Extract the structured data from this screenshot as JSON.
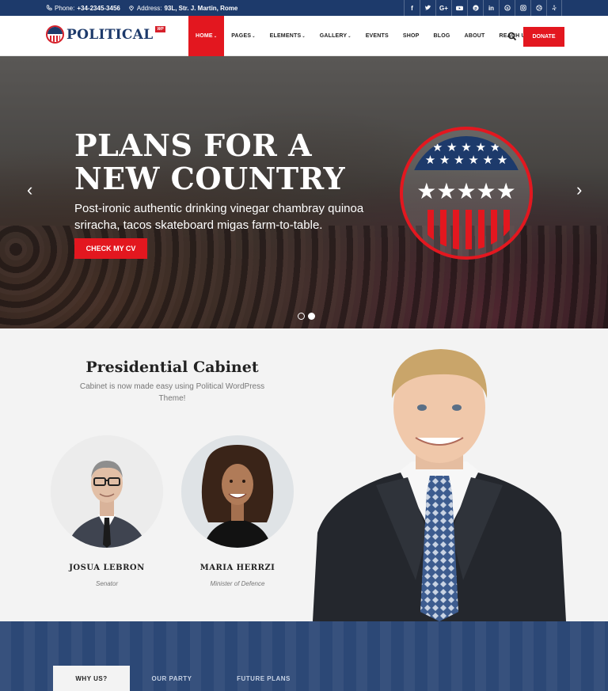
{
  "topbar": {
    "phone_label": "Phone:",
    "phone": "+34-2345-3456",
    "address_label": "Address:",
    "address": "93L, Str. J. Martin, Rome",
    "social": [
      "f",
      "t",
      "G+",
      "yt",
      "p",
      "in",
      "s",
      "ig",
      "dr",
      "y"
    ]
  },
  "header": {
    "logo_text": "POLITICAL",
    "logo_badge": "WP",
    "nav": [
      {
        "label": "HOME",
        "dropdown": true,
        "active": true
      },
      {
        "label": "PAGES",
        "dropdown": true
      },
      {
        "label": "ELEMENTS",
        "dropdown": true
      },
      {
        "label": "GALLERY",
        "dropdown": true
      },
      {
        "label": "EVENTS"
      },
      {
        "label": "SHOP"
      },
      {
        "label": "BLOG"
      },
      {
        "label": "ABOUT"
      },
      {
        "label": "REACH US"
      }
    ],
    "donate_label": "DONATE"
  },
  "hero": {
    "title_line1": "PLANS FOR A",
    "title_line2": "NEW COUNTRY",
    "lede": "Post-ironic authentic drinking vinegar chambray quinoa sriracha, tacos skateboard migas farm-to-table.",
    "cta_label": "CHECK MY CV",
    "slides": 2,
    "active_slide": 2
  },
  "cabinet": {
    "title": "Presidential Cabinet",
    "subtitle": "Cabinet is now made easy using Political WordPress Theme!",
    "members": [
      {
        "name": "JOSUA LEBRON",
        "role": "Senator"
      },
      {
        "name": "MARIA HERRZI",
        "role": "Minister of Defence"
      }
    ]
  },
  "tabs": [
    {
      "label": "WHY US?",
      "active": true
    },
    {
      "label": "OUR PARTY"
    },
    {
      "label": "FUTURE PLANS"
    }
  ],
  "colors": {
    "navy": "#1d3a6b",
    "red": "#e3171f",
    "light": "#f3f3f3"
  }
}
